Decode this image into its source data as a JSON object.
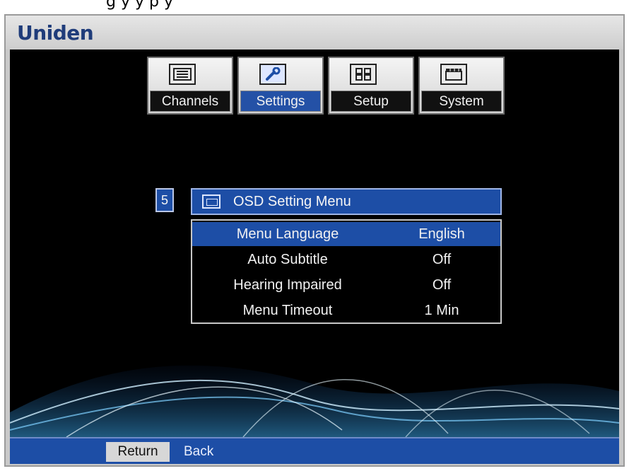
{
  "brand": "Uniden",
  "top_caption": "g                y         y                    p   y",
  "tabs": [
    {
      "label": "Channels",
      "icon": "list-icon",
      "active": false
    },
    {
      "label": "Settings",
      "icon": "wrench-icon",
      "active": true
    },
    {
      "label": "Setup",
      "icon": "grid-icon",
      "active": false
    },
    {
      "label": "System",
      "icon": "clapper-icon",
      "active": false
    }
  ],
  "menu": {
    "number": "5",
    "title": "OSD Setting Menu",
    "items": [
      {
        "label": "Menu Language",
        "value": "English",
        "selected": true
      },
      {
        "label": "Auto Subtitle",
        "value": "Off",
        "selected": false
      },
      {
        "label": "Hearing Impaired",
        "value": "Off",
        "selected": false
      },
      {
        "label": "Menu Timeout",
        "value": "1 Min",
        "selected": false
      }
    ]
  },
  "footer": {
    "return_label": "Return",
    "back_label": "Back"
  },
  "colors": {
    "accent": "#1d4ea6",
    "screen_bg": "#000000",
    "frame": "#c9c9c9"
  }
}
